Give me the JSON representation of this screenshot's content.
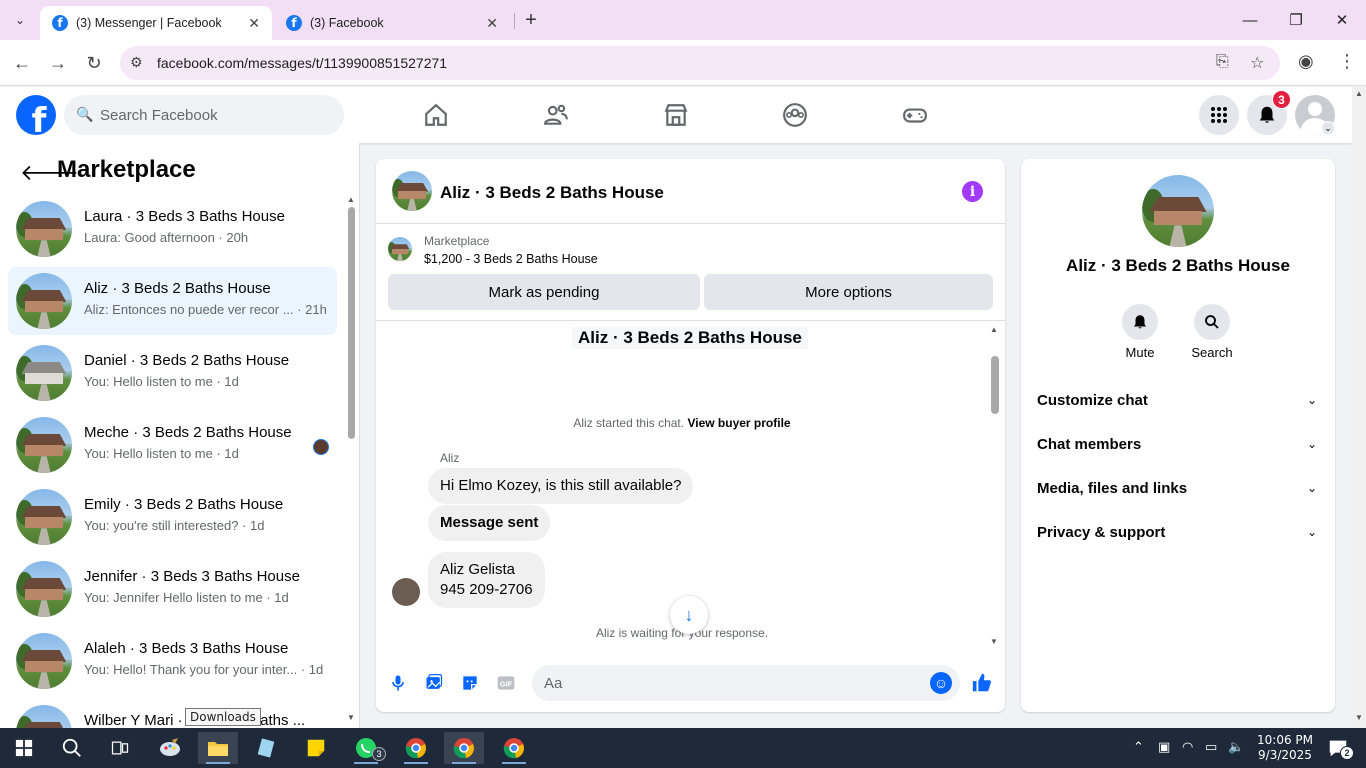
{
  "browser": {
    "tabs": [
      {
        "title": "(3) Messenger | Facebook",
        "active": true
      },
      {
        "title": "(3) Facebook",
        "active": false
      }
    ],
    "url": "facebook.com/messages/t/1139900851527271"
  },
  "fb_header": {
    "search_placeholder": "Search Facebook",
    "nav_icons": [
      "home-icon",
      "friends-icon",
      "marketplace-icon",
      "groups-icon",
      "gaming-icon"
    ],
    "notification_count": "3"
  },
  "left_panel": {
    "title": "Marketplace",
    "chats": [
      {
        "name": "Laura · 3 Beds 3 Baths House",
        "preview": "Laura: Good afternoon · 20h",
        "active": false
      },
      {
        "name": "Aliz · 3 Beds 2 Baths House",
        "preview": "Aliz: Entonces no puede ver recor ... · 21h",
        "active": true
      },
      {
        "name": "Daniel · 3 Beds 2 Baths House",
        "preview": "You: Hello listen to me · 1d",
        "active": false
      },
      {
        "name": "Meche · 3 Beds 2 Baths House",
        "preview": "You: Hello listen to me · 1d",
        "active": false
      },
      {
        "name": "Emily · 3 Beds 2 Baths House",
        "preview": "You: you're still interested? · 1d",
        "active": false
      },
      {
        "name": "Jennifer · 3 Beds 3 Baths House",
        "preview": "You: Jennifer Hello listen to me · 1d",
        "active": false
      },
      {
        "name": "Alaleh · 3 Beds 3 Baths House",
        "preview": "You: Hello! Thank you for your inter... · 1d",
        "active": false
      },
      {
        "name": "Wilber Y Mari · 3 Beds 3 Baths ...",
        "preview": "",
        "active": false
      }
    ],
    "tooltip": "Downloads"
  },
  "conversation": {
    "title": "Aliz · 3 Beds 2 Baths House",
    "marketplace_label": "Marketplace",
    "listing": "$1,200 - 3 Beds 2 Baths House",
    "mark_pending": "Mark as pending",
    "more_options": "More options",
    "listing_heading": "Aliz · 3 Beds 2 Baths House",
    "started_text": "Aliz started this chat.",
    "view_buyer_profile": "View buyer profile",
    "sender_name": "Aliz",
    "messages": [
      {
        "text": "Hi Elmo Kozey, is this still available?",
        "bold": false
      },
      {
        "text": "Message sent",
        "bold": true
      },
      {
        "text": "Aliz Gelista",
        "bold": false
      },
      {
        "text": "945 209-2706",
        "bold": false
      }
    ],
    "waiting_text": "Aliz is waiting for your response.",
    "composer_placeholder": "Aa"
  },
  "right_panel": {
    "name": "Aliz · 3 Beds 2 Baths House",
    "actions": [
      {
        "label": "Mute",
        "icon": "bell-icon"
      },
      {
        "label": "Search",
        "icon": "search-icon"
      }
    ],
    "sections": [
      "Customize chat",
      "Chat members",
      "Media, files and links",
      "Privacy & support"
    ]
  },
  "taskbar": {
    "time": "10:06 PM",
    "date": "9/3/2025",
    "whatsapp_badge": "3",
    "notification_count": "2"
  },
  "colors": {
    "facebook_blue": "#0866ff",
    "messenger_purple": "#a33bff",
    "badge_red": "#e41e3f",
    "active_chat_bg": "#ebf5ff"
  }
}
